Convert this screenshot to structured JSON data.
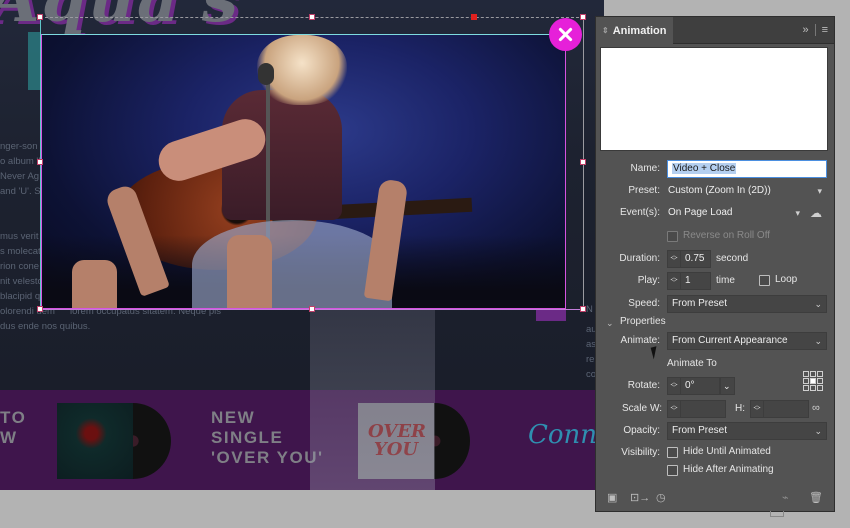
{
  "document": {
    "script_title": "Aqua's",
    "side_text_lines": [
      "nger-son",
      "o album 'I",
      "Never Ag",
      "and 'U'. Sh",
      "",
      "",
      "mus verit",
      "s molecat",
      "rion cone",
      "nit velesto",
      "blacipid q",
      "olorendi dem",
      "dus ende nos quibus."
    ],
    "lorem_overflow": "lorem occupatus sitatem. Neque pis",
    "right_text_lines": [
      "N",
      "au",
      "as",
      "re",
      "co"
    ],
    "band": {
      "left_text_lines": [
        "TO",
        "W"
      ],
      "single_lines": [
        "NEW",
        "SINGLE",
        "'OVER YOU'"
      ],
      "sleeve_text": "OVER YOU",
      "connect_text": "Connec"
    }
  },
  "selection": {
    "close_button_icon": "close-icon"
  },
  "panel": {
    "title": "Animation",
    "header_icons": [
      "collapse-icon",
      "panel-menu-icon"
    ],
    "name": {
      "label": "Name:",
      "value": "Video + Close"
    },
    "preset": {
      "label": "Preset:",
      "value": "Custom (Zoom In (2D))"
    },
    "events": {
      "label": "Event(s):",
      "value": "On Page Load"
    },
    "reverse_on_roll_off": {
      "label": "Reverse on Roll Off",
      "checked": false,
      "disabled": true
    },
    "duration": {
      "label": "Duration:",
      "value": "0.75",
      "unit": "second"
    },
    "play": {
      "label": "Play:",
      "value": "1",
      "unit": "time"
    },
    "loop": {
      "label": "Loop",
      "checked": false
    },
    "speed": {
      "label": "Speed:",
      "value": "From Preset"
    },
    "properties_heading": "Properties",
    "animate": {
      "label": "Animate:",
      "value": "From Current Appearance"
    },
    "animate_to_label": "Animate To",
    "rotate": {
      "label": "Rotate:",
      "value": "0°"
    },
    "scale": {
      "label": "Scale",
      "w_label": "W:",
      "w_value": "",
      "h_label": "H:",
      "h_value": ""
    },
    "opacity": {
      "label": "Opacity:",
      "value": "From Preset"
    },
    "visibility": {
      "label": "Visibility:",
      "hide_until_animated": {
        "label": "Hide Until Animated",
        "checked": false
      },
      "hide_after_animating": {
        "label": "Hide After Animating",
        "checked": false
      }
    },
    "footer_icons": [
      "preview-spread-icon",
      "preview-selection-icon",
      "timing-icon",
      "motion-path-icon",
      "delete-icon"
    ]
  },
  "colors": {
    "accent_magenta": "#e620d9",
    "selection_teal": "#5fc7c9",
    "panel_bg": "#535353",
    "band_purple": "#3f154c",
    "name_highlight": "#b4cff0"
  }
}
